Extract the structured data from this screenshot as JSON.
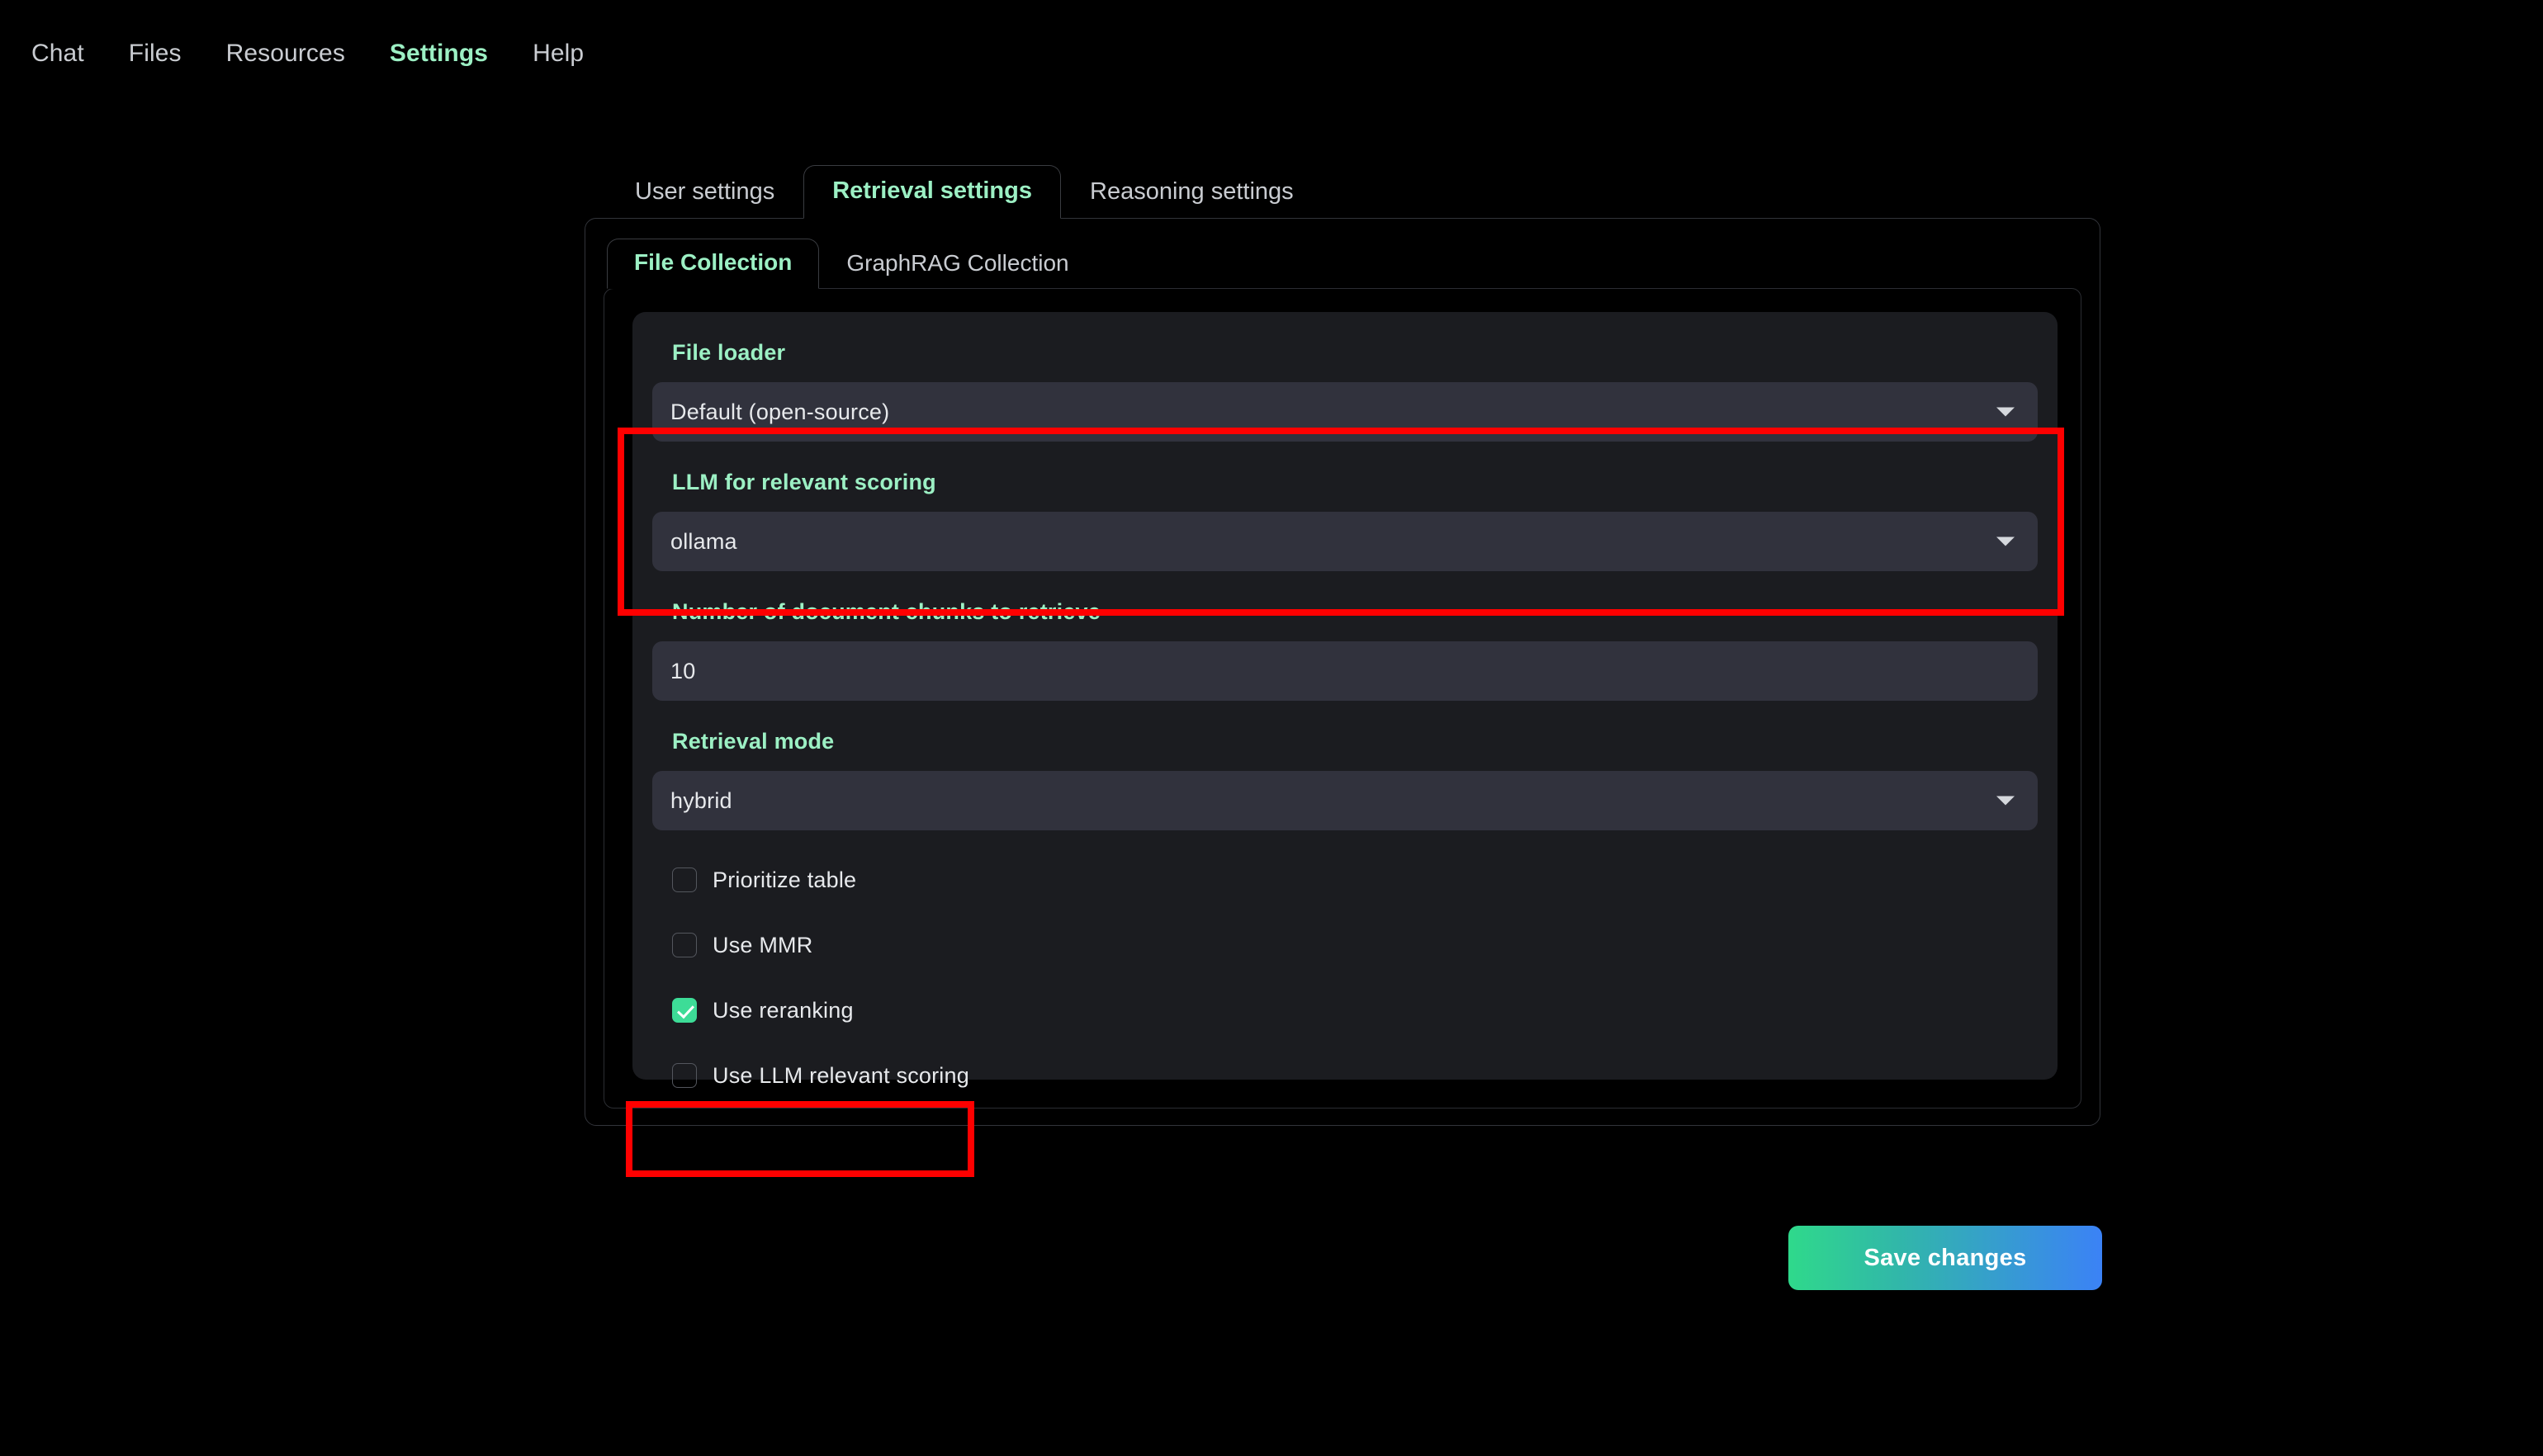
{
  "top_nav": {
    "items": [
      {
        "label": "Chat",
        "active": false
      },
      {
        "label": "Files",
        "active": false
      },
      {
        "label": "Resources",
        "active": false
      },
      {
        "label": "Settings",
        "active": true
      },
      {
        "label": "Help",
        "active": false
      }
    ]
  },
  "settings_tabs": {
    "items": [
      {
        "label": "User settings",
        "active": false
      },
      {
        "label": "Retrieval settings",
        "active": true
      },
      {
        "label": "Reasoning settings",
        "active": false
      }
    ]
  },
  "collection_tabs": {
    "items": [
      {
        "label": "File Collection",
        "active": true
      },
      {
        "label": "GraphRAG Collection",
        "active": false
      }
    ]
  },
  "form": {
    "file_loader": {
      "label": "File loader",
      "value": "Default (open-source)",
      "icon": "chevron-down-icon"
    },
    "llm_scoring": {
      "label": "LLM for relevant scoring",
      "value": "ollama",
      "icon": "chevron-down-icon",
      "highlighted": true
    },
    "chunks": {
      "label": "Number of document chunks to retrieve",
      "value": "10"
    },
    "retrieval_mode": {
      "label": "Retrieval mode",
      "value": "hybrid",
      "icon": "chevron-down-icon"
    },
    "checkboxes": [
      {
        "label": "Prioritize table",
        "checked": false,
        "highlighted": false
      },
      {
        "label": "Use MMR",
        "checked": false,
        "highlighted": false
      },
      {
        "label": "Use reranking",
        "checked": true,
        "highlighted": false
      },
      {
        "label": "Use LLM relevant scoring",
        "checked": false,
        "highlighted": true
      }
    ]
  },
  "actions": {
    "save_label": "Save changes"
  },
  "colors": {
    "accent_green": "#9cf0c4",
    "checkbox_green": "#3ddc97",
    "highlight_red": "#fe0000",
    "page_background": "#000000",
    "card_background": "#1b1c20",
    "control_background": "#31323d"
  }
}
